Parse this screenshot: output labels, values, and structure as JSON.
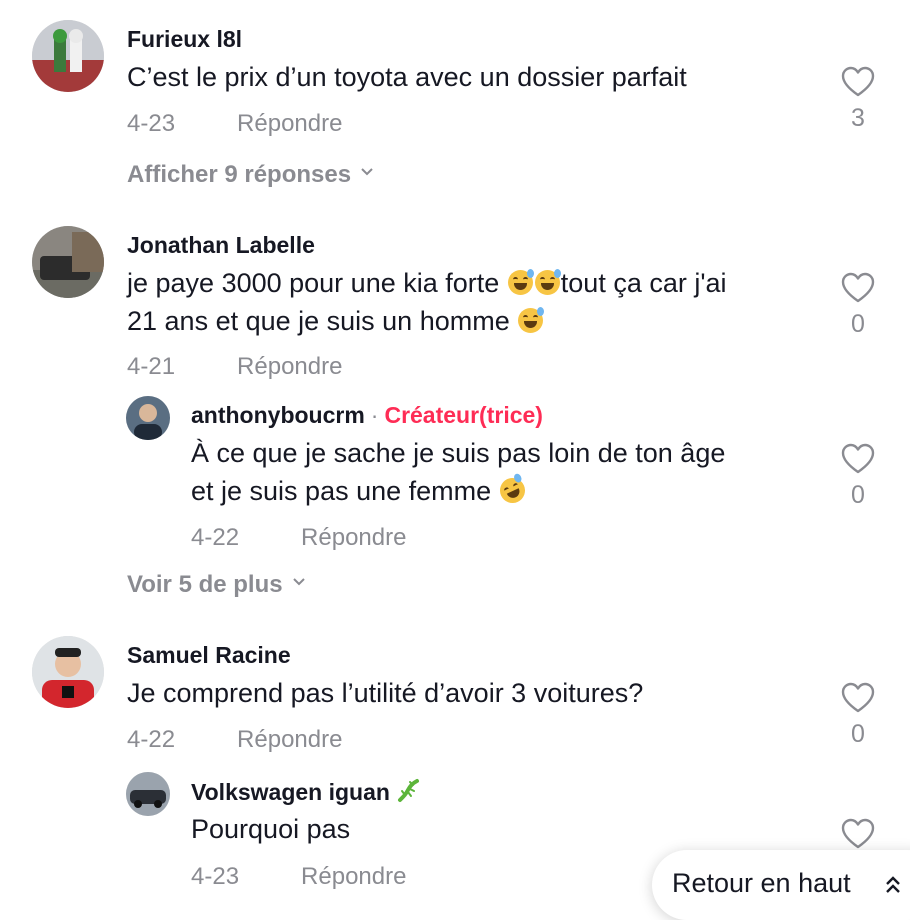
{
  "comments": [
    {
      "username": "Furieux l8l",
      "text": "C’est le prix d’un toyota avec un dossier parfait",
      "date": "4-23",
      "reply_label": "Répondre",
      "likes": "3",
      "more_label": "Afficher 9 réponses"
    },
    {
      "username": "Jonathan Labelle",
      "text_line1_a": "je paye 3000 pour une kia forte ",
      "text_line1_b": "tout ça car j'ai",
      "text_line2": "21 ans et que je suis un homme ",
      "date": "4-21",
      "reply_label": "Répondre",
      "likes": "0",
      "reply": {
        "username": "anthonyboucrm",
        "separator": "·",
        "badge": "Créateur(trice)",
        "text_line1": "À ce que je sache je suis pas loin de ton âge",
        "text_line2": "et je suis pas une femme ",
        "date": "4-22",
        "reply_label": "Répondre",
        "likes": "0"
      },
      "more_label": "Voir 5 de plus"
    },
    {
      "username": "Samuel Racine",
      "text": "Je comprend pas l’utilité d’avoir 3 voitures?",
      "date": "4-22",
      "reply_label": "Répondre",
      "likes": "0",
      "reply": {
        "username": "Volkswagen iguan",
        "text": "Pourquoi pas",
        "date": "4-23",
        "reply_label": "Répondre"
      }
    }
  ],
  "back_to_top": "Retour en haut",
  "colors": {
    "accent": "#fe2c55",
    "muted": "#8a8b91",
    "text": "#161823"
  },
  "icons": [
    "heart-outline-icon",
    "chevron-down-icon",
    "double-chevron-up-icon",
    "lizard-emoji",
    "sweat-smile-emoji",
    "rofl-emoji"
  ]
}
